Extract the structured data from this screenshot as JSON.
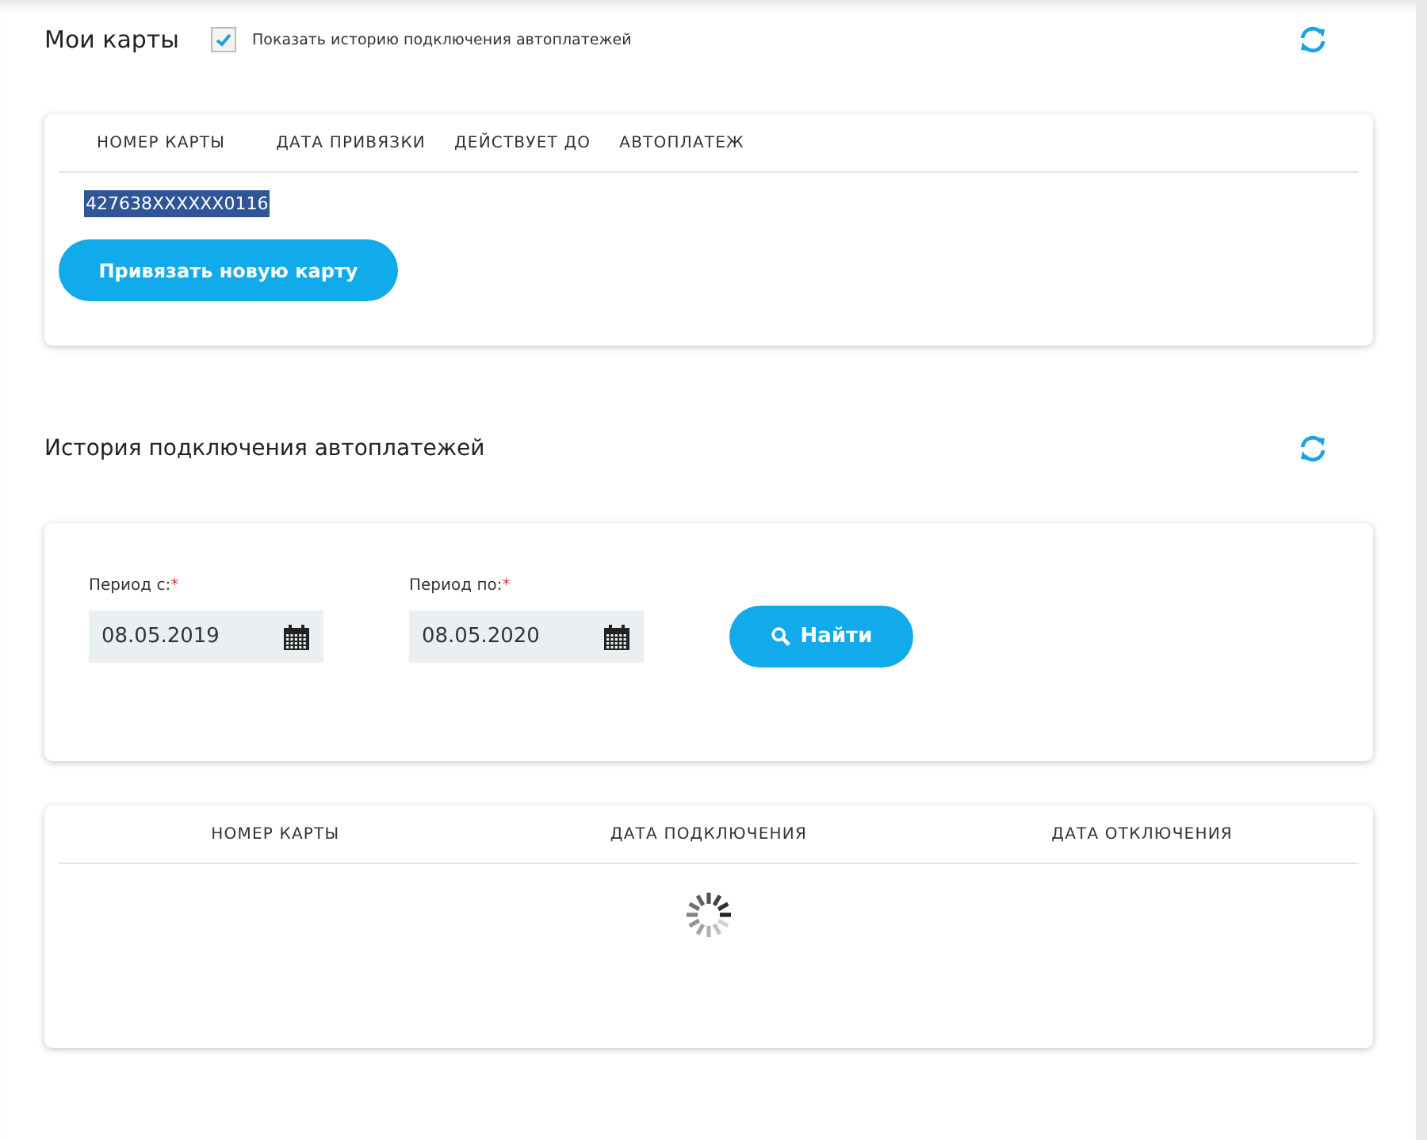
{
  "my_cards": {
    "title": "Мои карты",
    "show_history": {
      "label": "Показать историю подключения автоплатежей",
      "checked": true
    },
    "table": {
      "columns": [
        "НОМЕР КАРТЫ",
        "ДАТА ПРИВЯЗКИ",
        "ДЕЙСТВУЕТ ДО",
        "АВТОПЛАТЕЖ"
      ],
      "rows": [
        {
          "card_number": "427638XXXXXX0116",
          "selected": true
        }
      ]
    },
    "add_button": "Привязать новую карту"
  },
  "history": {
    "title": "История подключения автоплатежей",
    "filters": [
      {
        "label": "Период с:",
        "required_mark": "*",
        "value": "08.05.2019"
      },
      {
        "label": "Период по:",
        "required_mark": "*",
        "value": "08.05.2020"
      }
    ],
    "search_button": "Найти",
    "table": {
      "columns": [
        "НОМЕР КАРТЫ",
        "ДАТА ПОДКЛЮЧЕНИЯ",
        "ДАТА ОТКЛЮЧЕНИЯ"
      ],
      "loading": true
    }
  }
}
